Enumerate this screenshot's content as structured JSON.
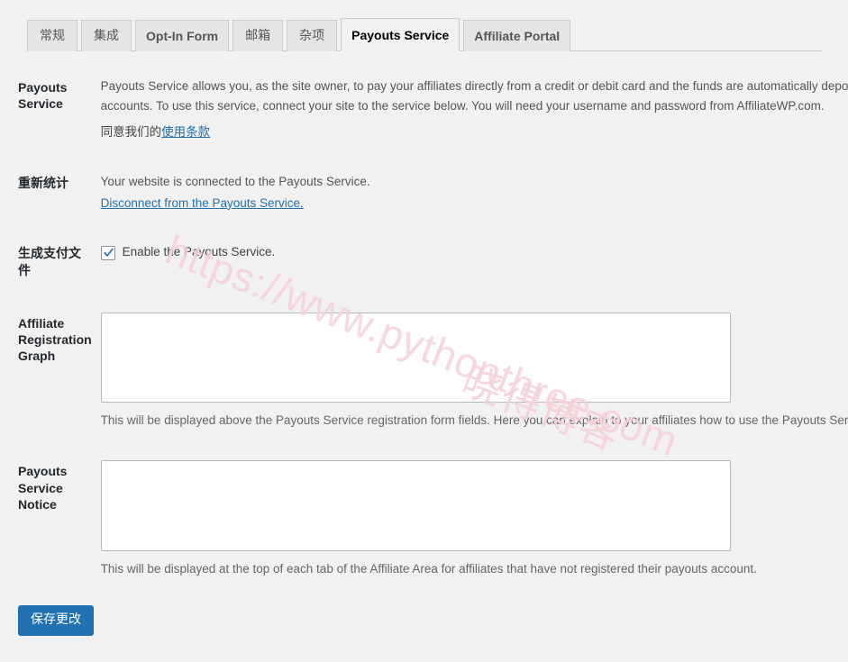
{
  "tabs": [
    {
      "label": "常规",
      "active": false,
      "cjk": true
    },
    {
      "label": "集成",
      "active": false,
      "cjk": true
    },
    {
      "label": "Opt-In Form",
      "active": false,
      "cjk": false
    },
    {
      "label": "邮箱",
      "active": false,
      "cjk": true
    },
    {
      "label": "杂项",
      "active": false,
      "cjk": true
    },
    {
      "label": "Payouts Service",
      "active": true,
      "cjk": false
    },
    {
      "label": "Affiliate Portal",
      "active": false,
      "cjk": false
    }
  ],
  "rows": {
    "payouts_service": {
      "label": "Payouts Service",
      "description": "Payouts Service allows you, as the site owner, to pay your affiliates directly from a credit or debit card and the funds are automatically deposited into their bank accounts. To use this service, connect your site to the service below. You will need your username and password from AffiliateWP.com.",
      "terms_prefix": "同意我们的",
      "terms_link": "使用条款"
    },
    "reconnect": {
      "label": "重新统计",
      "status": "Your website is connected to the Payouts Service.",
      "disconnect_link": "Disconnect from the Payouts Service."
    },
    "enable": {
      "label": "生成支付文件",
      "checkbox_label": "Enable the Payouts Service.",
      "checked": true
    },
    "registration_graph": {
      "label": "Affiliate Registration Graph",
      "value": "",
      "description": "This will be displayed above the Payouts Service registration form fields. Here you can explain to your affiliates how to use the Payouts Service."
    },
    "service_notice": {
      "label": "Payouts Service Notice",
      "value": "",
      "description": "This will be displayed at the top of each tab of the Affiliate Area for affiliates that have not registered their payouts account."
    }
  },
  "submit": {
    "save_label": "保存更改"
  },
  "watermark": {
    "url_text": "https://www.pythonthree.com",
    "cn_text": "晓得博客"
  },
  "colors": {
    "accent": "#2271b1",
    "link": "#2271b1",
    "page_bg": "#f1f1f1",
    "tab_bg": "#e5e5e5",
    "watermark": "#f6d2da"
  }
}
